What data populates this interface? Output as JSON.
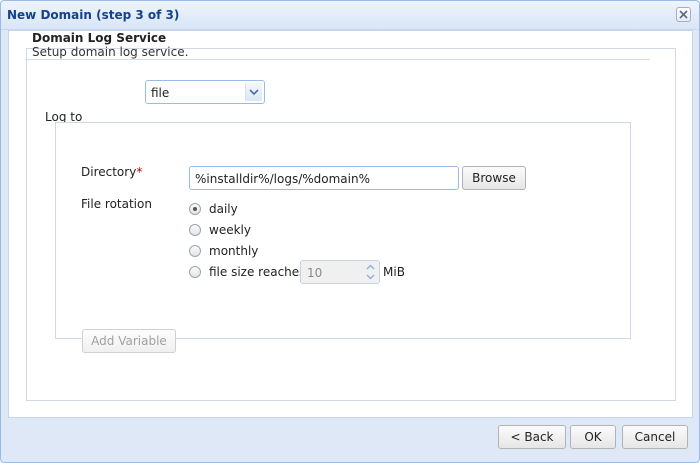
{
  "window": {
    "title": "New Domain (step 3 of 3)",
    "close_icon": "close-icon"
  },
  "header": {
    "title": "Domain Log Service",
    "subtitle": "Setup domain log service."
  },
  "log_to": {
    "label": "Log to",
    "selected": "file"
  },
  "directory": {
    "label": "Directory",
    "required_mark": "*",
    "value": "%installdir%/logs/%domain%",
    "browse_label": "Browse"
  },
  "rotation": {
    "label": "File rotation",
    "options": [
      {
        "label": "daily",
        "checked": true
      },
      {
        "label": "weekly",
        "checked": false
      },
      {
        "label": "monthly",
        "checked": false
      },
      {
        "label": "file size reaches",
        "checked": false
      }
    ],
    "size_value": "10",
    "size_unit": "MiB"
  },
  "add_variable_label": "Add Variable",
  "footer": {
    "back_label": "< Back",
    "ok_label": "OK",
    "cancel_label": "Cancel"
  }
}
